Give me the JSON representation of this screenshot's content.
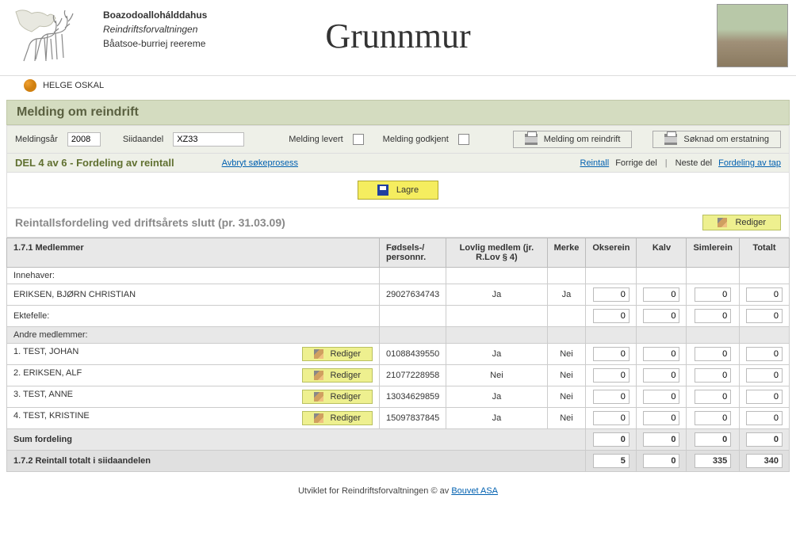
{
  "header": {
    "org_line1": "Boazodoallohálddahus",
    "org_line2": "Reindriftsforvaltningen",
    "org_line3": "Båatsoe-burriej reereme",
    "app_title": "Grunnmur"
  },
  "user": {
    "name": "HELGE OSKAL"
  },
  "section_title": "Melding om reindrift",
  "filter": {
    "year_label": "Meldingsår",
    "year_value": "2008",
    "siida_label": "Siidaandel",
    "siida_value": "XZ33",
    "levert_label": "Melding levert",
    "godkjent_label": "Melding godkjent",
    "btn_melding": "Melding om reindrift",
    "btn_soknad": "Søknad om erstatning"
  },
  "nav": {
    "part_title": "DEL 4 av 6 - Fordeling av reintall",
    "abort": "Avbryt søkeprosess",
    "reintall": "Reintall",
    "prev": "Forrige del",
    "next": "Neste del",
    "fordeling_tap": "Fordeling av tap"
  },
  "toolbar": {
    "save": "Lagre"
  },
  "subhead": {
    "title": "Reintallsfordeling ved driftsårets slutt (pr. 31.03.09)",
    "edit": "Rediger"
  },
  "table": {
    "headers": {
      "medlemmer": "1.7.1 Medlemmer",
      "fodsel": "Fødsels-/\npersonnr.",
      "lovlig": "Lovlig medlem (jr. R.Lov § 4)",
      "merke": "Merke",
      "okse": "Okserein",
      "kalv": "Kalv",
      "simle": "Simlerein",
      "totalt": "Totalt"
    },
    "innehaver_label": "Innehaver:",
    "innehaver_name": "ERIKSEN, BJØRN CHRISTIAN",
    "innehaver_fnr": "29027634743",
    "innehaver_lovlig": "Ja",
    "innehaver_merke": "Ja",
    "ektefelle_label": "Ektefelle:",
    "andre_label": "Andre medlemmer:",
    "members": [
      {
        "idx": "1.",
        "name": "TEST, JOHAN",
        "fnr": "01088439550",
        "lovlig": "Ja",
        "merke": "Nei",
        "okse": "0",
        "kalv": "0",
        "simle": "0",
        "tot": "0"
      },
      {
        "idx": "2.",
        "name": "ERIKSEN, ALF",
        "fnr": "21077228958",
        "lovlig": "Nei",
        "merke": "Nei",
        "okse": "0",
        "kalv": "0",
        "simle": "0",
        "tot": "0"
      },
      {
        "idx": "3.",
        "name": "TEST, ANNE",
        "fnr": "13034629859",
        "lovlig": "Ja",
        "merke": "Nei",
        "okse": "0",
        "kalv": "0",
        "simle": "0",
        "tot": "0"
      },
      {
        "idx": "4.",
        "name": "TEST, KRISTINE",
        "fnr": "15097837845",
        "lovlig": "Ja",
        "merke": "Nei",
        "okse": "0",
        "kalv": "0",
        "simle": "0",
        "tot": "0"
      }
    ],
    "edit_label": "Rediger",
    "sum_label": "Sum fordeling",
    "sum": {
      "okse": "0",
      "kalv": "0",
      "simle": "0",
      "tot": "0"
    },
    "total_label": "1.7.2 Reintall totalt i siidaandelen",
    "total": {
      "okse": "5",
      "kalv": "0",
      "simle": "335",
      "tot": "340"
    },
    "innehaver_vals": {
      "okse": "0",
      "kalv": "0",
      "simle": "0",
      "tot": "0"
    },
    "ektefelle_vals": {
      "okse": "0",
      "kalv": "0",
      "simle": "0",
      "tot": "0"
    }
  },
  "footer": {
    "text_pre": "Utviklet for Reindriftsforvaltningen © av ",
    "link": "Bouvet ASA"
  }
}
